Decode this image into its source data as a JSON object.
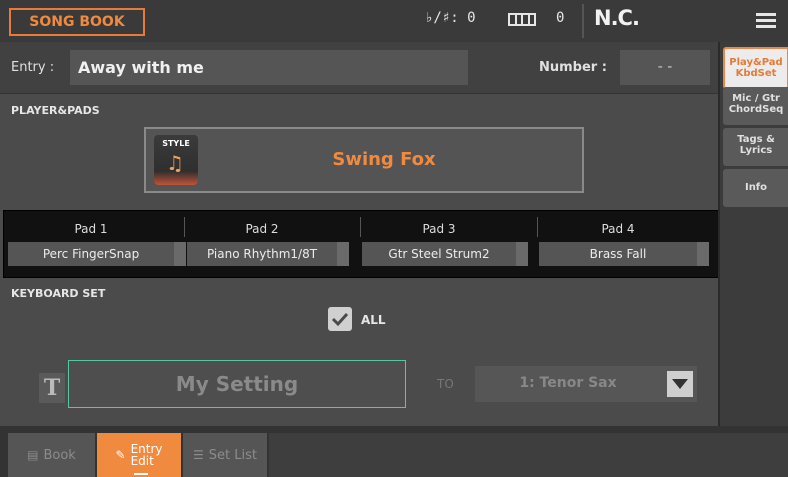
{
  "header": {
    "title": "SONG BOOK",
    "transpose": "♭/♯: 0",
    "octave": "0",
    "chord": "N.C."
  },
  "entry": {
    "label": "Entry :",
    "value": "Away with me",
    "number_label": "Number :",
    "number_value": "- -"
  },
  "player_pads": {
    "section_label": "PLAYER&PADS",
    "style_tag": "STYLE",
    "style_name": "Swing Fox",
    "pads": [
      {
        "label": "Pad 1",
        "value": "Perc FingerSnap"
      },
      {
        "label": "Pad 2",
        "value": "Piano Rhythm1/8T"
      },
      {
        "label": "Pad 3",
        "value": "Gtr Steel Strum2"
      },
      {
        "label": "Pad 4",
        "value": "Brass Fall"
      }
    ]
  },
  "keyboard_set": {
    "section_label": "KEYBOARD SET",
    "all_label": "ALL",
    "all_checked": true,
    "setting_name": "My Setting",
    "to_label": "TO",
    "target": "1: Tenor Sax"
  },
  "side_tabs": [
    {
      "line1": "Play&Pad",
      "line2": "KbdSet",
      "active": true
    },
    {
      "line1": "Mic / Gtr",
      "line2": "ChordSeq",
      "active": false
    },
    {
      "line1": "Tags &",
      "line2": "Lyrics",
      "active": false
    },
    {
      "line1": "Info",
      "line2": "",
      "active": false
    }
  ],
  "bottom_tabs": {
    "book": "Book",
    "entry_edit_line1": "Entry",
    "entry_edit_line2": "Edit",
    "set_list": "Set List"
  },
  "colors": {
    "accent": "#f08a3f",
    "highlight_border": "#58c7a0"
  }
}
